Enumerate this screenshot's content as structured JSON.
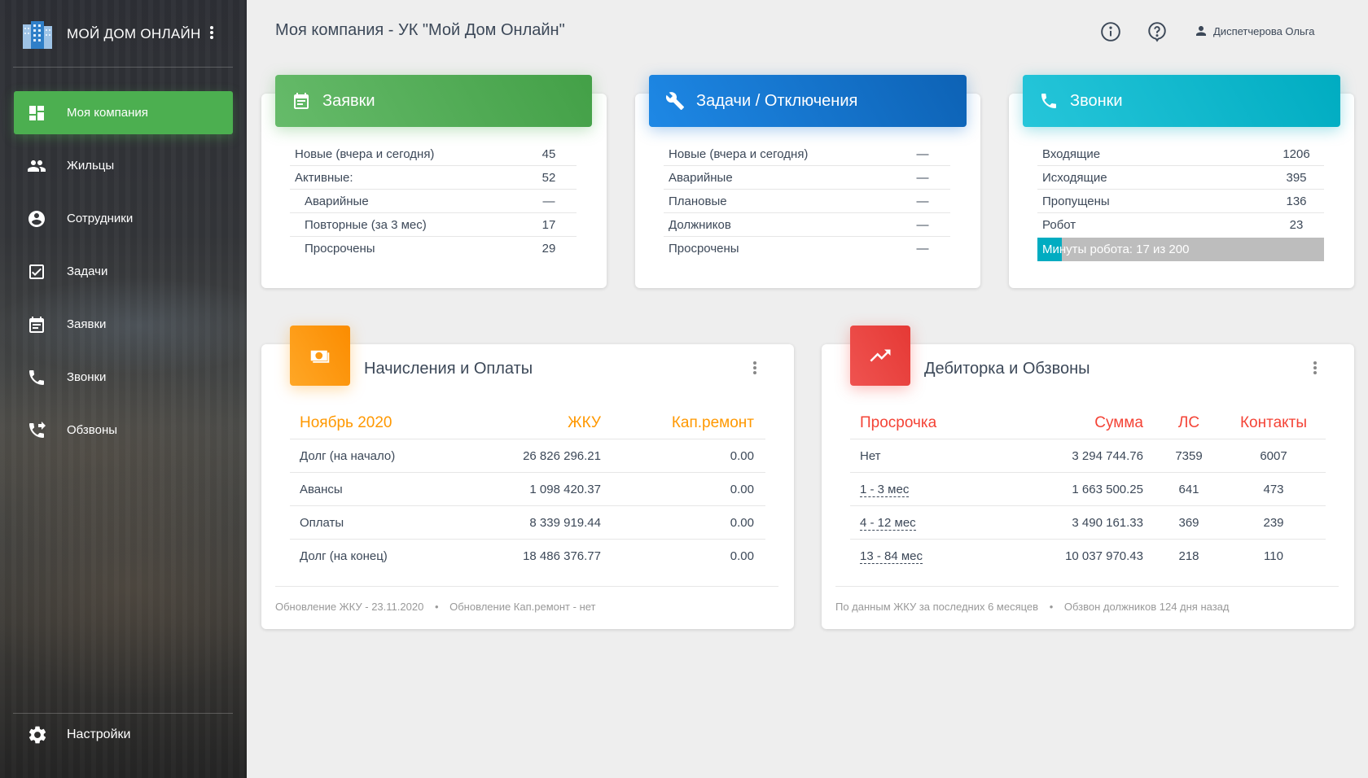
{
  "app": {
    "brand": "МОЙ ДОМ ОНЛАЙН",
    "page_title": "Моя компания - УК \"Мой Дом Онлайн\"",
    "user_name": "Диспетчерова Ольга"
  },
  "sidebar": {
    "items": [
      {
        "label": "Моя компания",
        "icon": "dashboard-icon",
        "active": true
      },
      {
        "label": "Жильцы",
        "icon": "people-icon"
      },
      {
        "label": "Сотрудники",
        "icon": "account-circle-icon"
      },
      {
        "label": "Задачи",
        "icon": "assignment-check-icon"
      },
      {
        "label": "Заявки",
        "icon": "calendar-icon"
      },
      {
        "label": "Звонки",
        "icon": "phone-icon"
      },
      {
        "label": "Обзвоны",
        "icon": "phone-forwarded-icon"
      }
    ],
    "settings_label": "Настройки"
  },
  "colors": {
    "green": "#4caf50",
    "blue": "#1976d2",
    "cyan": "#00acc1",
    "orange": "#ff9800",
    "red": "#f44336"
  },
  "zayavki": {
    "title": "Заявки",
    "rows": [
      {
        "label": "Новые (вчера и сегодня)",
        "value": "45"
      },
      {
        "label": "Активные:",
        "value": "52"
      },
      {
        "label": "Аварийные",
        "value": "—"
      },
      {
        "label": "Повторные (за 3 мес)",
        "value": "17"
      },
      {
        "label": "Просрочены",
        "value": "29"
      }
    ]
  },
  "zadachi": {
    "title": "Задачи / Отключения",
    "rows": [
      {
        "label": "Новые (вчера и сегодня)",
        "value": "—"
      },
      {
        "label": "Аварийные",
        "value": "—"
      },
      {
        "label": "Плановые",
        "value": "—"
      },
      {
        "label": "Должников",
        "value": "—"
      },
      {
        "label": "Просрочены",
        "value": "—"
      }
    ]
  },
  "zvonki": {
    "title": "Звонки",
    "rows": [
      {
        "label": "Входящие",
        "value": "1206"
      },
      {
        "label": "Исходящие",
        "value": "395"
      },
      {
        "label": "Пропущены",
        "value": "136"
      },
      {
        "label": "Робот",
        "value": "23"
      }
    ],
    "robot_text": "Минуты робота: 17 из 200",
    "robot_used": 17,
    "robot_total": 200
  },
  "nachisleniya": {
    "title": "Начисления и Оплаты",
    "headers": [
      "Ноябрь 2020",
      "ЖКУ",
      "Кап.ремонт"
    ],
    "rows": [
      [
        "Долг (на начало)",
        "26 826 296.21",
        "0.00"
      ],
      [
        "Авансы",
        "1 098 420.37",
        "0.00"
      ],
      [
        "Оплаты",
        "8 339 919.44",
        "0.00"
      ],
      [
        "Долг (на конец)",
        "18 486 376.77",
        "0.00"
      ]
    ],
    "footer_1": "Обновление ЖКУ - 23.11.2020",
    "footer_sep": "•",
    "footer_2": "Обновление Кап.ремонт - нет"
  },
  "debitorka": {
    "title": "Дебиторка и Обзвоны",
    "headers": [
      "Просрочка",
      "Сумма",
      "ЛС",
      "Контакты"
    ],
    "rows": [
      [
        "Нет",
        "3 294 744.76",
        "7359",
        "6007"
      ],
      [
        "1 - 3 мес",
        "1 663 500.25",
        "641",
        "473"
      ],
      [
        "4 - 12 мес",
        "3 490 161.33",
        "369",
        "239"
      ],
      [
        "13 - 84 мес",
        "10 037 970.43",
        "218",
        "110"
      ]
    ],
    "footer_1": "По данным ЖКУ за последних 6 месяцев",
    "footer_sep": "•",
    "footer_2": "Обзвон должников 124 дня назад"
  }
}
